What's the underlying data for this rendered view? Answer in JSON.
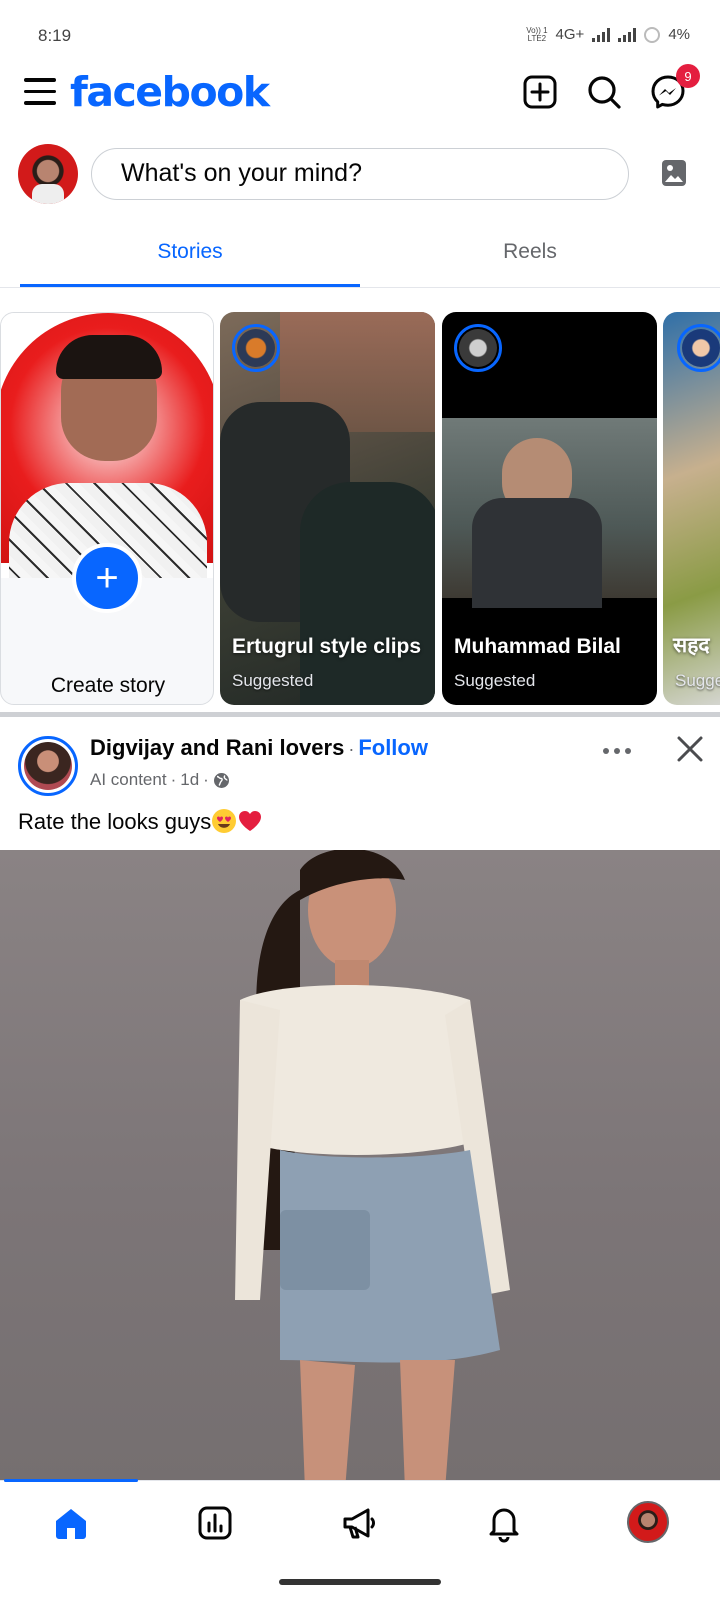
{
  "status_bar": {
    "time": "8:19",
    "network_top": "Vo)) 1",
    "network_bottom": "LTE2",
    "network_type": "4G+",
    "battery": "4%"
  },
  "header": {
    "logo": "facebook",
    "messenger_badge": "9",
    "icons": [
      "menu-icon",
      "create-icon",
      "search-icon",
      "messenger-icon"
    ]
  },
  "composer": {
    "placeholder": "What's on your mind?",
    "photo_icon": "photo-icon"
  },
  "tabs": [
    {
      "label": "Stories",
      "active": true
    },
    {
      "label": "Reels",
      "active": false
    }
  ],
  "stories": [
    {
      "title": "Create story"
    },
    {
      "title": "Ertugrul style clips",
      "subtitle": "Suggested"
    },
    {
      "title": "Muhammad Bilal",
      "subtitle": "Suggested"
    },
    {
      "title": "सहद",
      "subtitle": "Sugge"
    }
  ],
  "post": {
    "page_name": "Digvijay and Rani lovers",
    "separator": "·",
    "follow_label": "Follow",
    "label": "AI content",
    "time": "1d",
    "audience_icon": "globe-icon",
    "text": "Rate the looks guys"
  },
  "bottom_nav": {
    "items": [
      "home-icon",
      "dashboard-icon",
      "megaphone-icon",
      "bell-icon",
      "profile-avatar"
    ],
    "active": "home-icon"
  },
  "colors": {
    "brand": "#0866ff",
    "badge": "#e41e3f",
    "secondary_text": "#65676b"
  }
}
